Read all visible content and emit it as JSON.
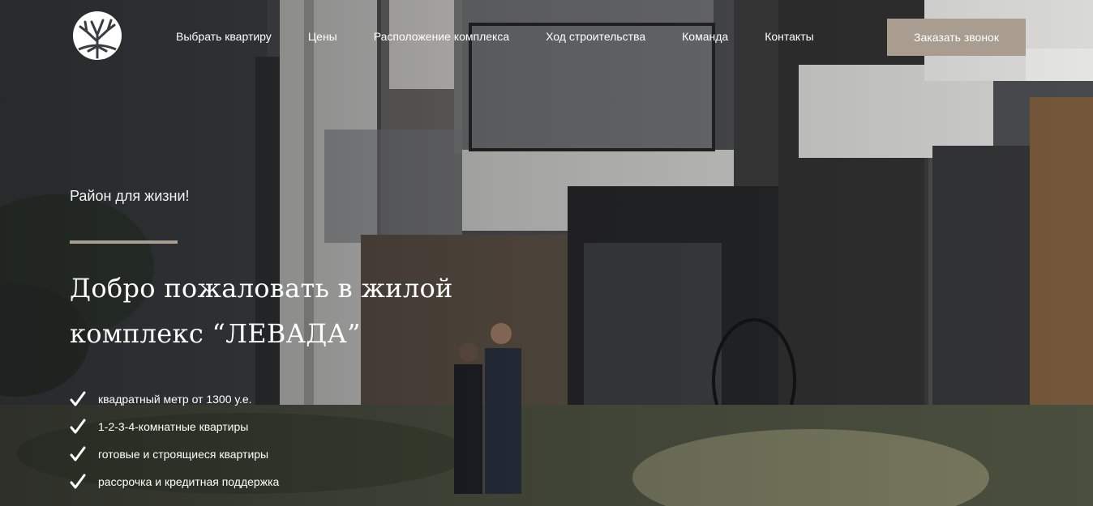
{
  "header": {
    "logo_icon": "tree-logo-icon",
    "nav": [
      {
        "label": "Выбрать квартиру"
      },
      {
        "label": "Цены"
      },
      {
        "label": "Расположение комплекса"
      },
      {
        "label": "Ход строительства"
      },
      {
        "label": "Команда"
      },
      {
        "label": "Контакты"
      }
    ],
    "callback_label": "Заказать звонок"
  },
  "hero": {
    "kicker": "Район для жизни!",
    "title_line1": "Добро пожаловать в жилой",
    "title_line2": "комплекс “ЛЕВАДА”",
    "features": [
      {
        "icon": "checkmark-icon",
        "text": "квадратный метр от 1300 у.е."
      },
      {
        "icon": "checkmark-icon",
        "text": "1-2-3-4-комнатные квартиры"
      },
      {
        "icon": "checkmark-icon",
        "text": "готовые и строящиеся квартиры"
      },
      {
        "icon": "checkmark-icon",
        "text": "рассрочка и кредитная поддержка"
      }
    ]
  },
  "colors": {
    "accent": "#a89d8f",
    "text": "#ffffff"
  }
}
